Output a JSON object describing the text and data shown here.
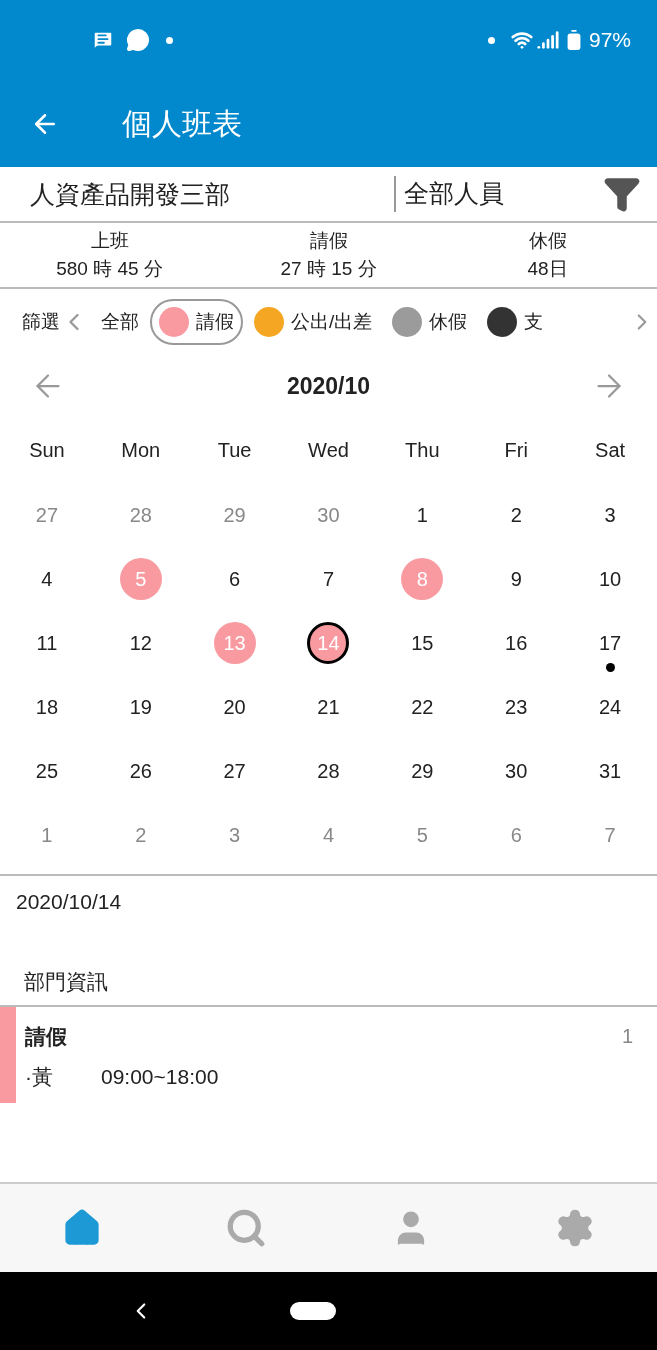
{
  "status_bar": {
    "battery": "97%"
  },
  "app_bar": {
    "title": "個人班表"
  },
  "selector": {
    "department": "人資產品開發三部",
    "people": "全部人員"
  },
  "summary": [
    {
      "label": "上班",
      "value": "580 時 45 分"
    },
    {
      "label": "請假",
      "value": "27 時 15 分"
    },
    {
      "label": "休假",
      "value": "48日"
    }
  ],
  "filter": {
    "label": "篩選",
    "chips": [
      {
        "label": "全部",
        "selected": false
      },
      {
        "label": "請假",
        "color": "#f99aa1",
        "selected": true
      },
      {
        "label": "公出/出差",
        "color": "#f5a623",
        "selected": false
      },
      {
        "label": "休假",
        "color": "#9b9b9b",
        "selected": false
      },
      {
        "label": "支",
        "color": "#333333",
        "selected": false
      }
    ]
  },
  "calendar": {
    "month": "2020/10",
    "weekdays": [
      "Sun",
      "Mon",
      "Tue",
      "Wed",
      "Thu",
      "Fri",
      "Sat"
    ],
    "weeks": [
      [
        {
          "label": "27",
          "muted": true
        },
        {
          "label": "28",
          "muted": true
        },
        {
          "label": "29",
          "muted": true
        },
        {
          "label": "30",
          "muted": true
        },
        {
          "label": "1",
          "muted": false
        },
        {
          "label": "2",
          "muted": false
        },
        {
          "label": "3",
          "muted": false
        }
      ],
      [
        {
          "label": "4",
          "muted": false
        },
        {
          "label": "5",
          "muted": false,
          "color": "#f99aa1"
        },
        {
          "label": "6",
          "muted": false
        },
        {
          "label": "7",
          "muted": false
        },
        {
          "label": "8",
          "muted": false,
          "color": "#f99aa1"
        },
        {
          "label": "9",
          "muted": false
        },
        {
          "label": "10",
          "muted": false
        }
      ],
      [
        {
          "label": "11",
          "muted": false
        },
        {
          "label": "12",
          "muted": false
        },
        {
          "label": "13",
          "muted": false,
          "color": "#f99aa1"
        },
        {
          "label": "14",
          "muted": false,
          "color": "#f99aa1",
          "selected": true
        },
        {
          "label": "15",
          "muted": false
        },
        {
          "label": "16",
          "muted": false
        },
        {
          "label": "17",
          "muted": false,
          "dot": true
        }
      ],
      [
        {
          "label": "18",
          "muted": false
        },
        {
          "label": "19",
          "muted": false
        },
        {
          "label": "20",
          "muted": false
        },
        {
          "label": "21",
          "muted": false
        },
        {
          "label": "22",
          "muted": false
        },
        {
          "label": "23",
          "muted": false
        },
        {
          "label": "24",
          "muted": false
        }
      ],
      [
        {
          "label": "25",
          "muted": false
        },
        {
          "label": "26",
          "muted": false
        },
        {
          "label": "27",
          "muted": false
        },
        {
          "label": "28",
          "muted": false
        },
        {
          "label": "29",
          "muted": false
        },
        {
          "label": "30",
          "muted": false
        },
        {
          "label": "31",
          "muted": false
        }
      ],
      [
        {
          "label": "1",
          "muted": true
        },
        {
          "label": "2",
          "muted": true
        },
        {
          "label": "3",
          "muted": true
        },
        {
          "label": "4",
          "muted": true
        },
        {
          "label": "5",
          "muted": true
        },
        {
          "label": "6",
          "muted": true
        },
        {
          "label": "7",
          "muted": true
        }
      ]
    ]
  },
  "detail": {
    "date": "2020/10/14",
    "section": "部門資訊",
    "events": [
      {
        "title": "請假",
        "count": "1",
        "color": "#f99aa1",
        "entries": [
          {
            "name": "·黃",
            "time": "09:00~18:00"
          }
        ]
      }
    ]
  },
  "bottom_nav": [
    {
      "kind": "home",
      "selected": true
    },
    {
      "kind": "search",
      "selected": false
    },
    {
      "kind": "person",
      "selected": false
    },
    {
      "kind": "settings",
      "selected": false
    }
  ]
}
